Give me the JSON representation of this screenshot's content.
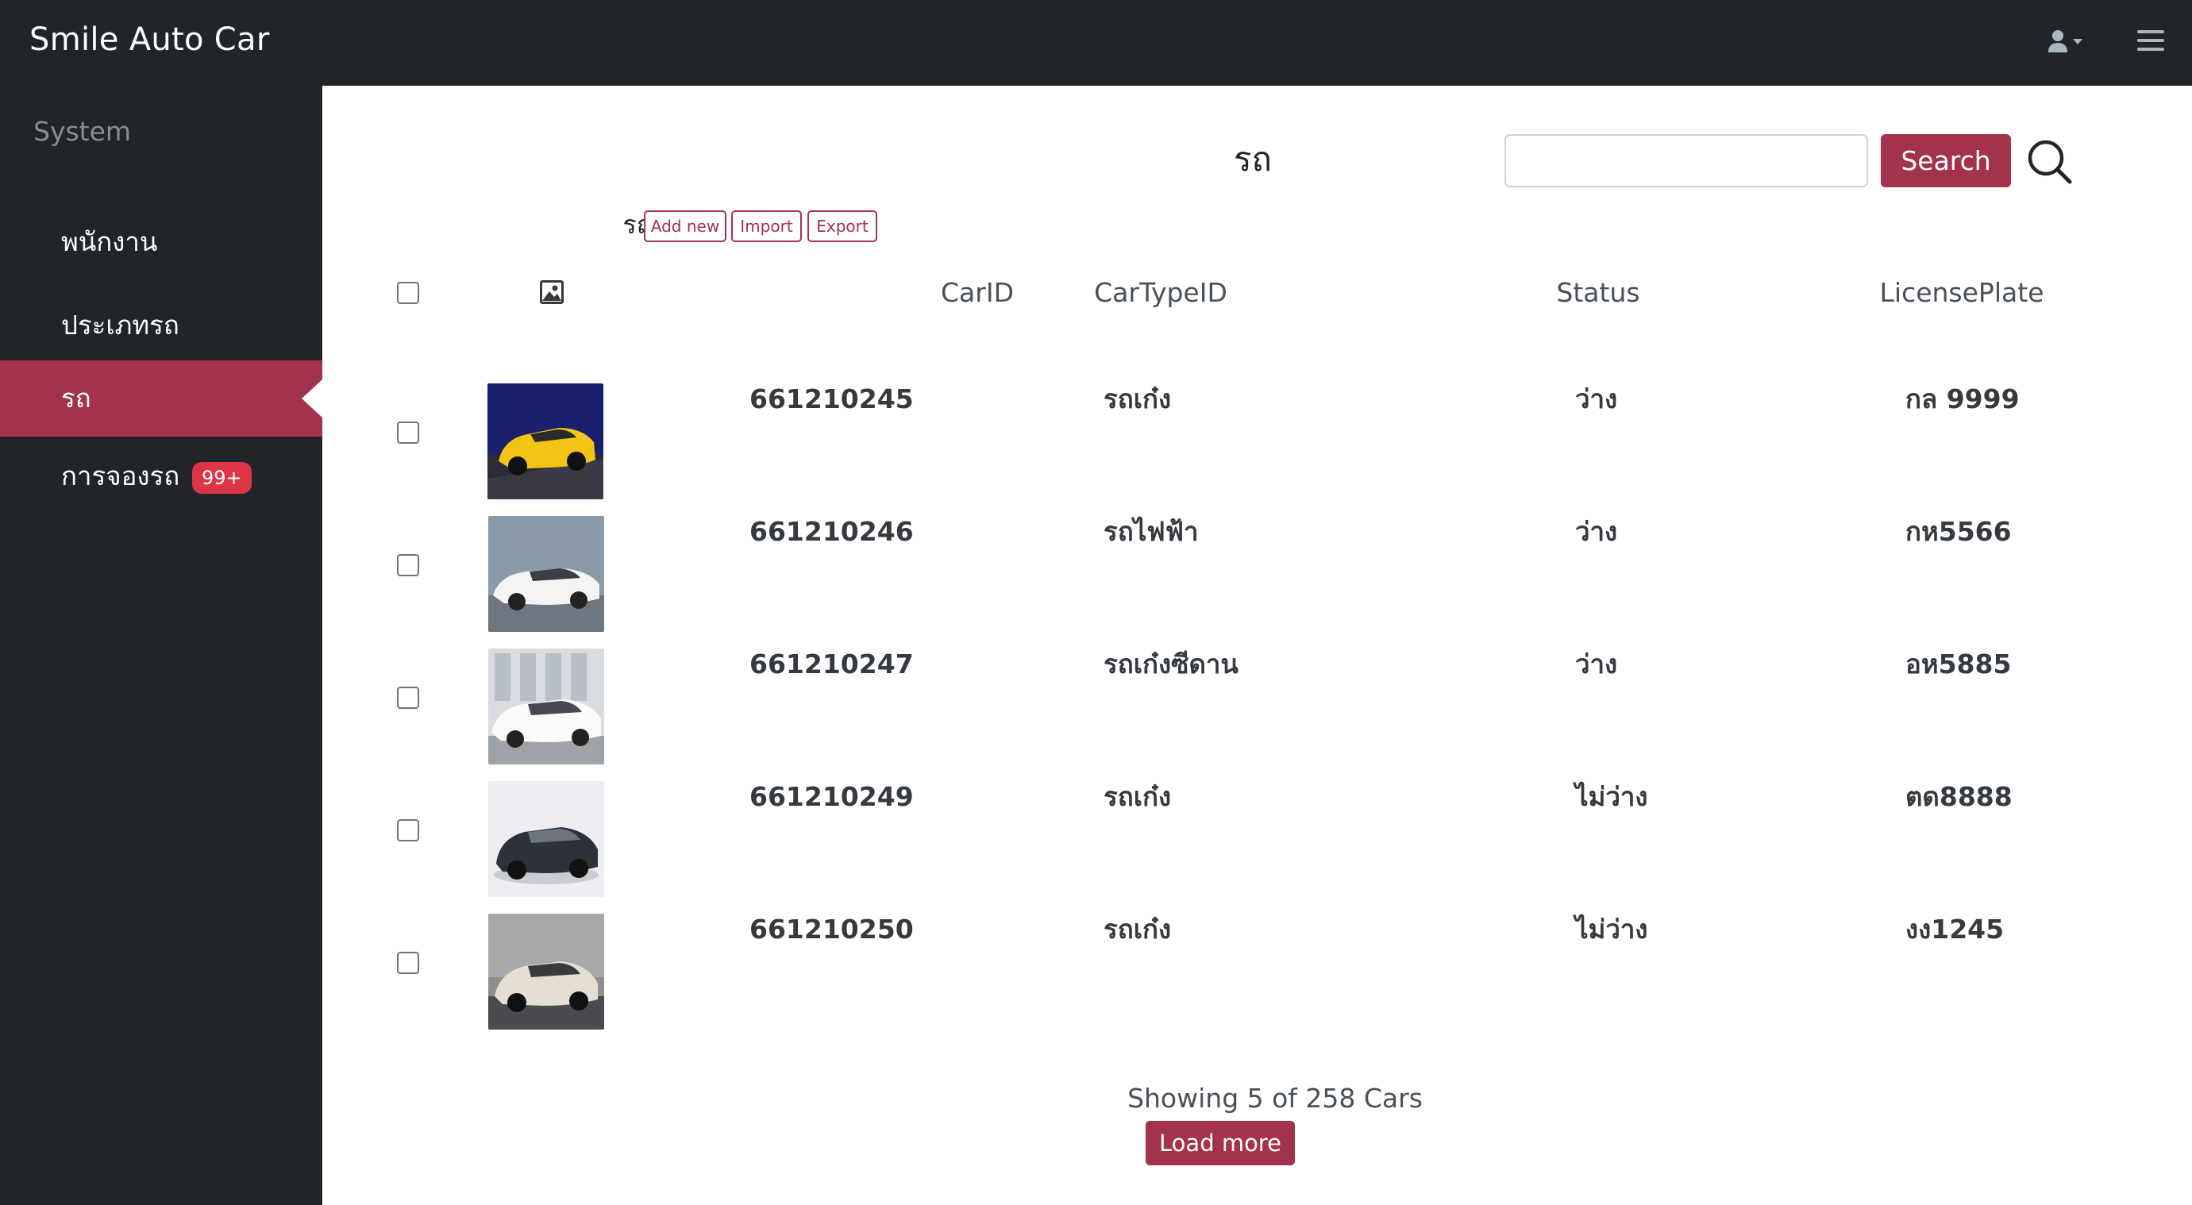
{
  "app": {
    "brand": "Smile Auto Car"
  },
  "sidebar": {
    "heading": "System",
    "items": [
      {
        "label": "พนักงาน"
      },
      {
        "label": "ประเภทรถ"
      },
      {
        "label": "รถ",
        "active": true
      },
      {
        "label": "การจองรถ",
        "badge": "99+"
      }
    ]
  },
  "page": {
    "title": "รถ",
    "search": {
      "value": "",
      "placeholder": "",
      "button": "Search"
    },
    "section_label": "รถ",
    "actions": {
      "add_new": "Add new",
      "import": "Import",
      "export": "Export"
    }
  },
  "table": {
    "columns": [
      "CarID",
      "CarTypeID",
      "Status",
      "LicensePlate"
    ],
    "rows": [
      {
        "car_id": "661210245",
        "car_type": "รถเก๋ง",
        "status": "ว่าง",
        "plate": "กล 9999",
        "image": "yellow-sports-car"
      },
      {
        "car_id": "661210246",
        "car_type": "รถไฟฟ้า",
        "status": "ว่าง",
        "plate": "กห5566",
        "image": "white-electric-car"
      },
      {
        "car_id": "661210247",
        "car_type": "รถเก๋งซีดาน",
        "status": "ว่าง",
        "plate": "อห5885",
        "image": "white-sedan"
      },
      {
        "car_id": "661210249",
        "car_type": "รถเก๋ง",
        "status": "ไม่ว่าง",
        "plate": "ตด8888",
        "image": "dark-hatchback"
      },
      {
        "car_id": "661210250",
        "car_type": "รถเก๋ง",
        "status": "ไม่ว่าง",
        "plate": "งง1245",
        "image": "beige-hatchback"
      }
    ]
  },
  "footer": {
    "showing": "Showing 5 of 258 Cars",
    "load_more": "Load more"
  },
  "colors": {
    "accent": "#a3324d",
    "dark": "#212529",
    "badge": "#dc3545"
  }
}
